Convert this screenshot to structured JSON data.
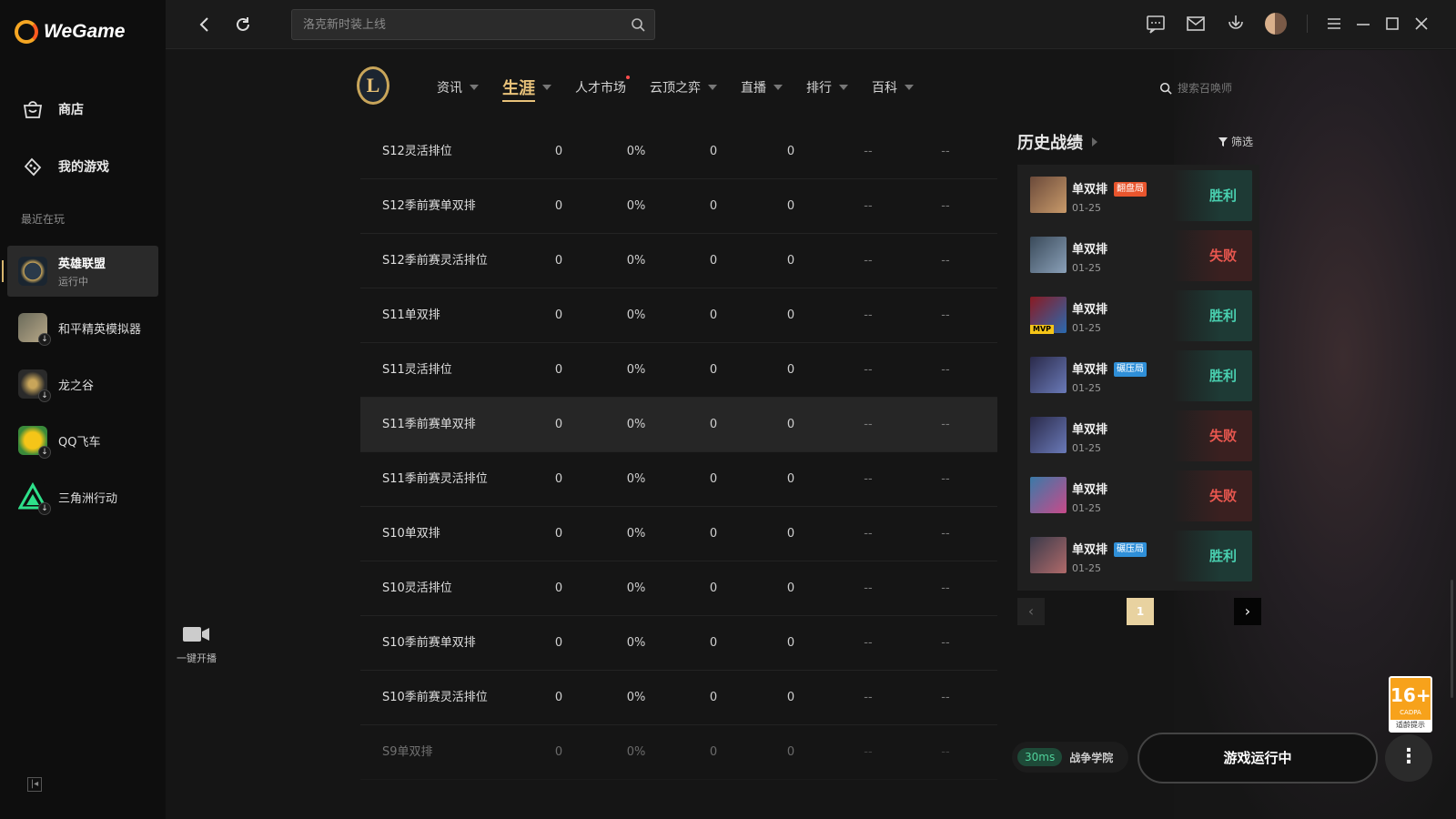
{
  "app": {
    "name": "WeGame"
  },
  "sidebar": {
    "nav": [
      {
        "label": "商店",
        "icon": "shop-icon"
      },
      {
        "label": "我的游戏",
        "icon": "gamepad-icon"
      }
    ],
    "recent_title": "最近在玩",
    "games": [
      {
        "name": "英雄联盟",
        "status": "运行中",
        "icon": "lol-icon",
        "active": true
      },
      {
        "name": "和平精英模拟器",
        "status": "",
        "icon": "pubg-icon",
        "download": true
      },
      {
        "name": "龙之谷",
        "status": "",
        "icon": "dragon-nest-icon",
        "download": true
      },
      {
        "name": "QQ飞车",
        "status": "",
        "icon": "qq-speed-icon",
        "download": true
      },
      {
        "name": "三角洲行动",
        "status": "",
        "icon": "delta-force-icon",
        "download": true
      }
    ]
  },
  "topbar": {
    "search_placeholder": "洛克新时装上线"
  },
  "tabs": [
    {
      "label": "资讯",
      "caret": true
    },
    {
      "label": "生涯",
      "caret": true,
      "active": true
    },
    {
      "label": "人才市场",
      "dot": true
    },
    {
      "label": "云顶之弈",
      "caret": true
    },
    {
      "label": "直播",
      "caret": true
    },
    {
      "label": "排行",
      "caret": true
    },
    {
      "label": "百科",
      "caret": true
    }
  ],
  "summoner_search_placeholder": "搜索召唤师",
  "table_rows": [
    {
      "name": "S12灵活排位",
      "c1": "0",
      "c2": "0%",
      "c3": "0",
      "c4": "0",
      "c5": "--",
      "c6": "--"
    },
    {
      "name": "S12季前赛单双排",
      "c1": "0",
      "c2": "0%",
      "c3": "0",
      "c4": "0",
      "c5": "--",
      "c6": "--"
    },
    {
      "name": "S12季前赛灵活排位",
      "c1": "0",
      "c2": "0%",
      "c3": "0",
      "c4": "0",
      "c5": "--",
      "c6": "--"
    },
    {
      "name": "S11单双排",
      "c1": "0",
      "c2": "0%",
      "c3": "0",
      "c4": "0",
      "c5": "--",
      "c6": "--"
    },
    {
      "name": "S11灵活排位",
      "c1": "0",
      "c2": "0%",
      "c3": "0",
      "c4": "0",
      "c5": "--",
      "c6": "--"
    },
    {
      "name": "S11季前赛单双排",
      "c1": "0",
      "c2": "0%",
      "c3": "0",
      "c4": "0",
      "c5": "--",
      "c6": "--",
      "highlight": true
    },
    {
      "name": "S11季前赛灵活排位",
      "c1": "0",
      "c2": "0%",
      "c3": "0",
      "c4": "0",
      "c5": "--",
      "c6": "--"
    },
    {
      "name": "S10单双排",
      "c1": "0",
      "c2": "0%",
      "c3": "0",
      "c4": "0",
      "c5": "--",
      "c6": "--"
    },
    {
      "name": "S10灵活排位",
      "c1": "0",
      "c2": "0%",
      "c3": "0",
      "c4": "0",
      "c5": "--",
      "c6": "--"
    },
    {
      "name": "S10季前赛单双排",
      "c1": "0",
      "c2": "0%",
      "c3": "0",
      "c4": "0",
      "c5": "--",
      "c6": "--"
    },
    {
      "name": "S10季前赛灵活排位",
      "c1": "0",
      "c2": "0%",
      "c3": "0",
      "c4": "0",
      "c5": "--",
      "c6": "--"
    },
    {
      "name": "S9单双排",
      "c1": "0",
      "c2": "0%",
      "c3": "0",
      "c4": "0",
      "c5": "--",
      "c6": "--",
      "faded": true
    }
  ],
  "history": {
    "title": "历史战绩",
    "filter_label": "筛选",
    "matches": [
      {
        "mode": "单双排",
        "tag": "翻盘局",
        "tag_color": "#e8552d",
        "date": "01-25",
        "result": "胜利",
        "win": true,
        "champ_colors": [
          "#6b4a3a",
          "#c89a6a"
        ]
      },
      {
        "mode": "单双排",
        "tag": "",
        "date": "01-25",
        "result": "失败",
        "win": false,
        "champ_colors": [
          "#3a4a5a",
          "#8aa0b8"
        ]
      },
      {
        "mode": "单双排",
        "tag": "",
        "date": "01-25",
        "result": "胜利",
        "win": true,
        "mvp": "MVP",
        "champ_colors": [
          "#8a1a22",
          "#2a6ab0"
        ]
      },
      {
        "mode": "单双排",
        "tag": "碾压局",
        "tag_color": "#2f8fd8",
        "date": "01-25",
        "result": "胜利",
        "win": true,
        "champ_colors": [
          "#2a2a4a",
          "#6a7ab8"
        ]
      },
      {
        "mode": "单双排",
        "tag": "",
        "date": "01-25",
        "result": "失败",
        "win": false,
        "champ_colors": [
          "#2a2a4a",
          "#6a7ab8"
        ]
      },
      {
        "mode": "单双排",
        "tag": "",
        "date": "01-25",
        "result": "失败",
        "win": false,
        "champ_colors": [
          "#3a7aa8",
          "#c84a8a"
        ]
      },
      {
        "mode": "单双排",
        "tag": "碾压局",
        "tag_color": "#2f8fd8",
        "date": "01-25",
        "result": "胜利",
        "win": true,
        "champ_colors": [
          "#3a3a4a",
          "#b06a6a"
        ]
      }
    ],
    "current_page": "1"
  },
  "stream_label": "一键开播",
  "age_badge": {
    "number": "16+",
    "sub": "CADPA",
    "tip": "适龄提示"
  },
  "ping": {
    "ms": "30ms",
    "server": "战争学院"
  },
  "launch_label": "游戏运行中",
  "colors": {
    "accent": "#e8c27a",
    "win": "#49d0b0",
    "lose": "#e9574f"
  }
}
